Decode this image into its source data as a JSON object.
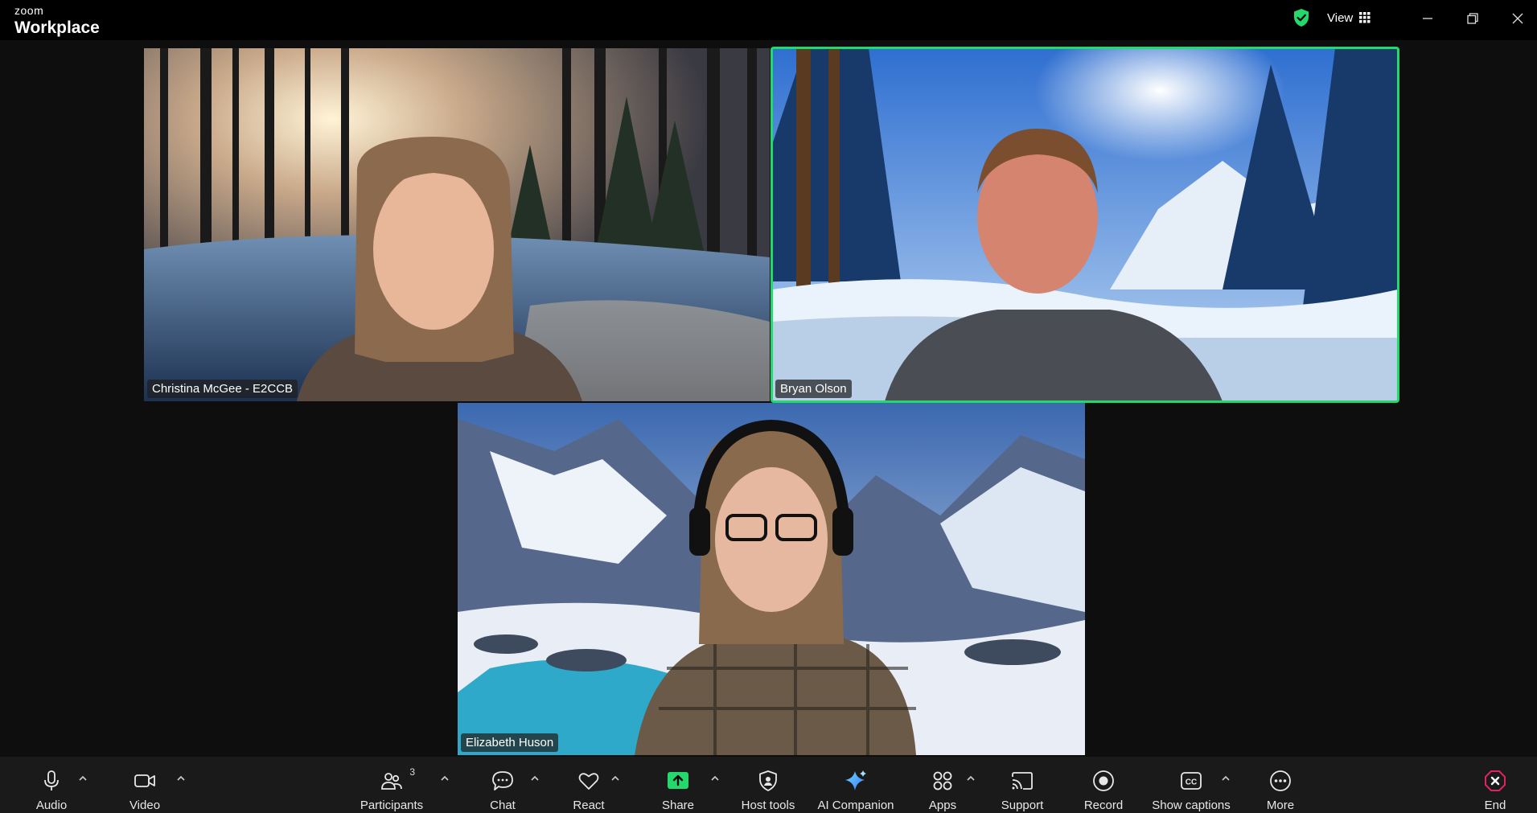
{
  "app": {
    "brand_top": "zoom",
    "brand_main": "Workplace",
    "view_label": "View"
  },
  "participants": [
    {
      "name": "Christina McGee - E2CCB",
      "speaking": false
    },
    {
      "name": "Bryan Olson",
      "speaking": true
    },
    {
      "name": "Elizabeth Huson",
      "speaking": false
    }
  ],
  "toolbar": {
    "audio": "Audio",
    "video": "Video",
    "participants": "Participants",
    "participant_count": "3",
    "chat": "Chat",
    "react": "React",
    "share": "Share",
    "host_tools": "Host tools",
    "ai_companion": "AI Companion",
    "apps": "Apps",
    "support": "Support",
    "record": "Record",
    "show_captions": "Show captions",
    "more": "More",
    "end": "End"
  },
  "colors": {
    "speaking_border": "#23d96c",
    "share_green": "#23d96c",
    "end_red": "#e0245e",
    "toolbar_bg": "#1a1a1a",
    "stage_bg": "#0e0e0e"
  }
}
